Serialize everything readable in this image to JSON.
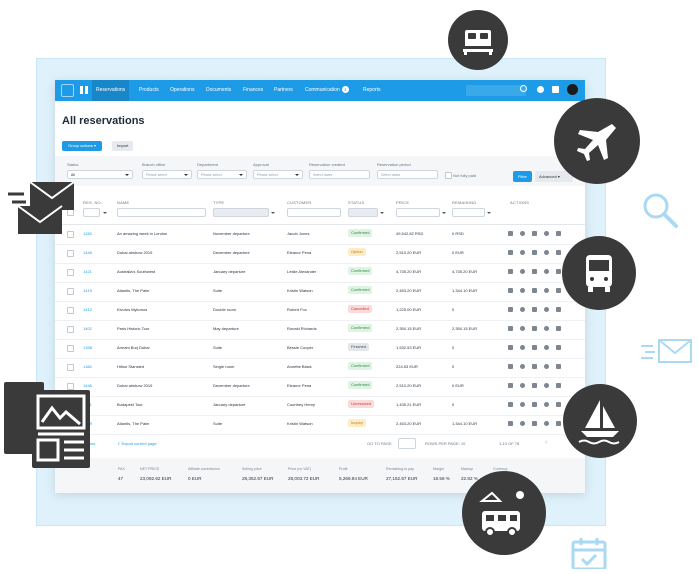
{
  "nav": {
    "items": [
      "Reservations",
      "Products",
      "Operations",
      "Documents",
      "Finances",
      "Partners",
      "Communication",
      "Reports"
    ],
    "communication_badge": "3"
  },
  "page": {
    "title": "All reservations"
  },
  "actions": {
    "group_actions": "Group actions",
    "import": "Import"
  },
  "filters": {
    "status_label": "Status",
    "status_value": "All",
    "branch_label": "Branch office",
    "branch_placeholder": "Please select",
    "department_label": "Department",
    "department_placeholder": "Please select",
    "approval_label": "Approval",
    "approval_placeholder": "Please select",
    "created_label": "Reservation created",
    "created_placeholder": "Select dates",
    "period_label": "Reservation period",
    "period_placeholder": "Select dates",
    "not_fully_paid": "Not fully paid",
    "filter_button": "Filter",
    "advanced_button": "Advanced"
  },
  "table": {
    "headers": {
      "res_no": "RES. NO.",
      "name": "NAME",
      "type": "TYPE",
      "customer": "CUSTOMER",
      "status": "STATUS",
      "price": "PRICE",
      "remaining": "REMAINING",
      "actions": "ACTIONS"
    },
    "rows": [
      {
        "res_no": "1283",
        "name": "An amazing week in London",
        "type": "November departure",
        "customer": "Jacob Jones",
        "status": "Confirmed",
        "status_kind": "confirmed",
        "price": "49,542.82 RSD",
        "remaining": "0 RSD"
      },
      {
        "res_no": "1446",
        "name": "Dubai airshow 2019",
        "type": "December departure",
        "customer": "Eleanor Pena",
        "status": "Option",
        "status_kind": "option",
        "price": "2,510.20 EUR",
        "remaining": "0 EUR"
      },
      {
        "res_no": "1421",
        "name": "Australia's Southwest",
        "type": "January departure",
        "customer": "Leslie Alexander",
        "status": "Confirmed",
        "status_kind": "confirmed",
        "price": "4,735.20 EUR",
        "remaining": "4,735.20 EUR"
      },
      {
        "res_no": "1419",
        "name": "Atlantis, The Palm",
        "type": "Suite",
        "customer": "Kristin Watson",
        "status": "Confirmed",
        "status_kind": "confirmed",
        "price": "2,453.20 EUR",
        "remaining": "1,344.10 EUR"
      },
      {
        "res_no": "1412",
        "name": "Kivotos Mykonos",
        "type": "Double room",
        "customer": "Robert Fox",
        "status": "Cancelled",
        "status_kind": "cancelled",
        "price": "1,225.00 EUR",
        "remaining": "0"
      },
      {
        "res_no": "1402",
        "name": "Paris Historic Tour",
        "type": "May departure",
        "customer": "Ronald Richards",
        "status": "Confirmed",
        "status_kind": "confirmed",
        "price": "2,350.15 EUR",
        "remaining": "2,350.15 EUR"
      },
      {
        "res_no": "1398",
        "name": "Armani Burj Dubai",
        "type": "Suite",
        "customer": "Bessie Cooper",
        "status": "Finished",
        "status_kind": "finished",
        "price": "1,532.53 EUR",
        "remaining": "0"
      },
      {
        "res_no": "1382",
        "name": "Hilton Stansted",
        "type": "Single room",
        "customer": "Annette Black",
        "status": "Confirmed",
        "status_kind": "confirmed",
        "price": "224.53 EUR",
        "remaining": "0"
      },
      {
        "res_no": "1446",
        "name": "Dubai airshow 2019",
        "type": "December departure",
        "customer": "Eleanor Pena",
        "status": "Confirmed",
        "status_kind": "confirmed",
        "price": "2,510.20 EUR",
        "remaining": "0 EUR"
      },
      {
        "res_no": "1421",
        "name": "Budapest Tour",
        "type": "January departure",
        "customer": "Courtney Henry",
        "status": "Unresolved",
        "status_kind": "unresolved",
        "price": "1,435.21 EUR",
        "remaining": "0"
      },
      {
        "res_no": "1419",
        "name": "Atlantis, The Palm",
        "type": "Suite",
        "customer": "Kristin Watson",
        "status": "Inquiry",
        "status_kind": "inquiry",
        "price": "2,453.20 EUR",
        "remaining": "1,344.10 EUR"
      }
    ]
  },
  "pager": {
    "export_prefix": "ions",
    "export_label": "Export current page",
    "go_to_page": "GO TO PAGE",
    "rows_per_page": "ROWS PER PAGE: 10",
    "range": "1-10 OF 78"
  },
  "summary": [
    {
      "label": "PAX",
      "value": "47"
    },
    {
      "label": "NET PRICE",
      "value": "23,092.62 EUR"
    },
    {
      "label": "Affiliate commission",
      "value": "0 EUR"
    },
    {
      "label": "Selling price",
      "value": "28,362.57 EUR"
    },
    {
      "label": "Price (no VAT)",
      "value": "28,003.72 EUR"
    },
    {
      "label": "Profit",
      "value": "5,269.94 EUR"
    },
    {
      "label": "Remaining to pay",
      "value": "27,162.57 EUR"
    },
    {
      "label": "Margin",
      "value": "18.58 %"
    },
    {
      "label": "Markup",
      "value": "22.82 %"
    },
    {
      "label": "Currency",
      "value": ""
    }
  ],
  "decor_icons": [
    "bed-icon",
    "airplane-icon",
    "search-icon",
    "bus-icon",
    "envelope-icon",
    "sailboat-icon",
    "camper-van-icon",
    "calendar-icon",
    "newspaper-icon",
    "mail-stack-icon"
  ],
  "colors": {
    "accent": "#1e9be6",
    "dark_circle": "#3a3a3a",
    "frame": "#dff1fb"
  }
}
